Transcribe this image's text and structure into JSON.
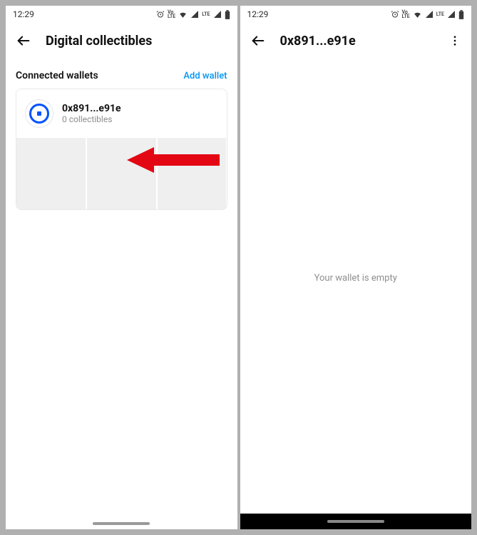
{
  "status": {
    "time": "12:29",
    "lte_top": "Vo",
    "lte_bottom": "LTE",
    "signal_text": "LTE"
  },
  "screen1": {
    "title": "Digital collectibles",
    "section_label": "Connected wallets",
    "add_wallet_label": "Add wallet",
    "wallet": {
      "name": "0x891...e91e",
      "subtitle": "0 collectibles"
    }
  },
  "screen2": {
    "title": "0x891...e91e",
    "empty_message": "Your wallet is empty"
  }
}
